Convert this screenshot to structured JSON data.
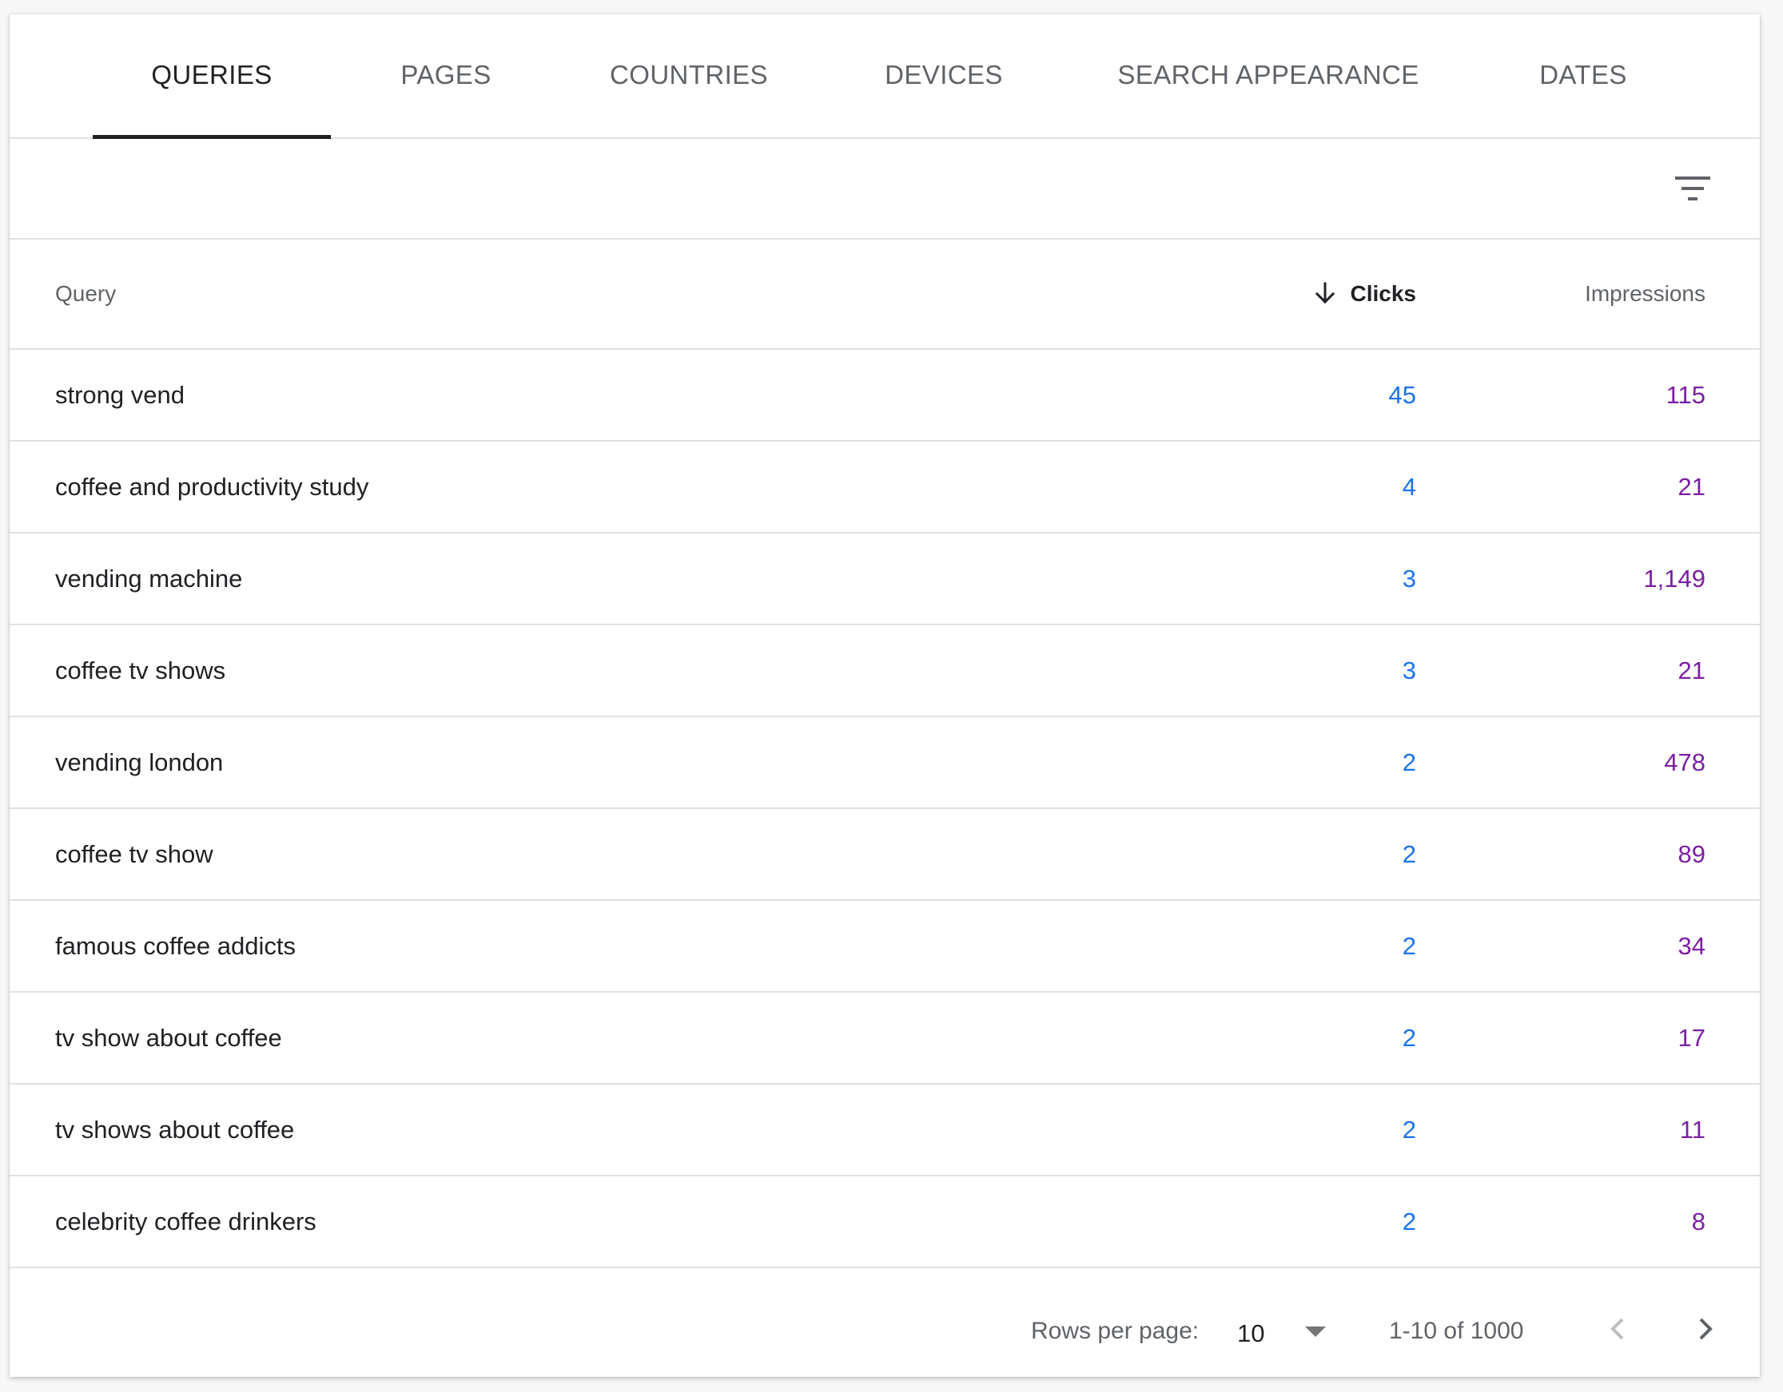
{
  "tabs": [
    {
      "label": "QUERIES",
      "active": true
    },
    {
      "label": "PAGES",
      "active": false
    },
    {
      "label": "COUNTRIES",
      "active": false
    },
    {
      "label": "DEVICES",
      "active": false
    },
    {
      "label": "SEARCH APPEARANCE",
      "active": false
    },
    {
      "label": "DATES",
      "active": false
    }
  ],
  "toolbar": {
    "filter_icon": "filter-list-icon"
  },
  "table": {
    "columns": {
      "query": "Query",
      "clicks": "Clicks",
      "impressions": "Impressions"
    },
    "sort": {
      "column": "clicks",
      "direction": "descending",
      "icon": "arrow-down-icon"
    },
    "rows": [
      {
        "query": "strong vend",
        "clicks": "45",
        "impressions": "115"
      },
      {
        "query": "coffee and productivity study",
        "clicks": "4",
        "impressions": "21"
      },
      {
        "query": "vending machine",
        "clicks": "3",
        "impressions": "1,149"
      },
      {
        "query": "coffee tv shows",
        "clicks": "3",
        "impressions": "21"
      },
      {
        "query": "vending london",
        "clicks": "2",
        "impressions": "478"
      },
      {
        "query": "coffee tv show",
        "clicks": "2",
        "impressions": "89"
      },
      {
        "query": "famous coffee addicts",
        "clicks": "2",
        "impressions": "34"
      },
      {
        "query": "tv show about coffee",
        "clicks": "2",
        "impressions": "17"
      },
      {
        "query": "tv shows about coffee",
        "clicks": "2",
        "impressions": "11"
      },
      {
        "query": "celebrity coffee drinkers",
        "clicks": "2",
        "impressions": "8"
      }
    ]
  },
  "pagination": {
    "rows_per_page_label": "Rows per page:",
    "rows_per_page_value": "10",
    "range_text": "1-10 of 1000",
    "prev_icon": "chevron-left-icon",
    "next_icon": "chevron-right-icon"
  },
  "colors": {
    "clicks": "#1a73e8",
    "impressions": "#7b1fa2",
    "text_primary": "#202124",
    "text_secondary": "#5f6368",
    "divider": "#e0e0e0"
  }
}
